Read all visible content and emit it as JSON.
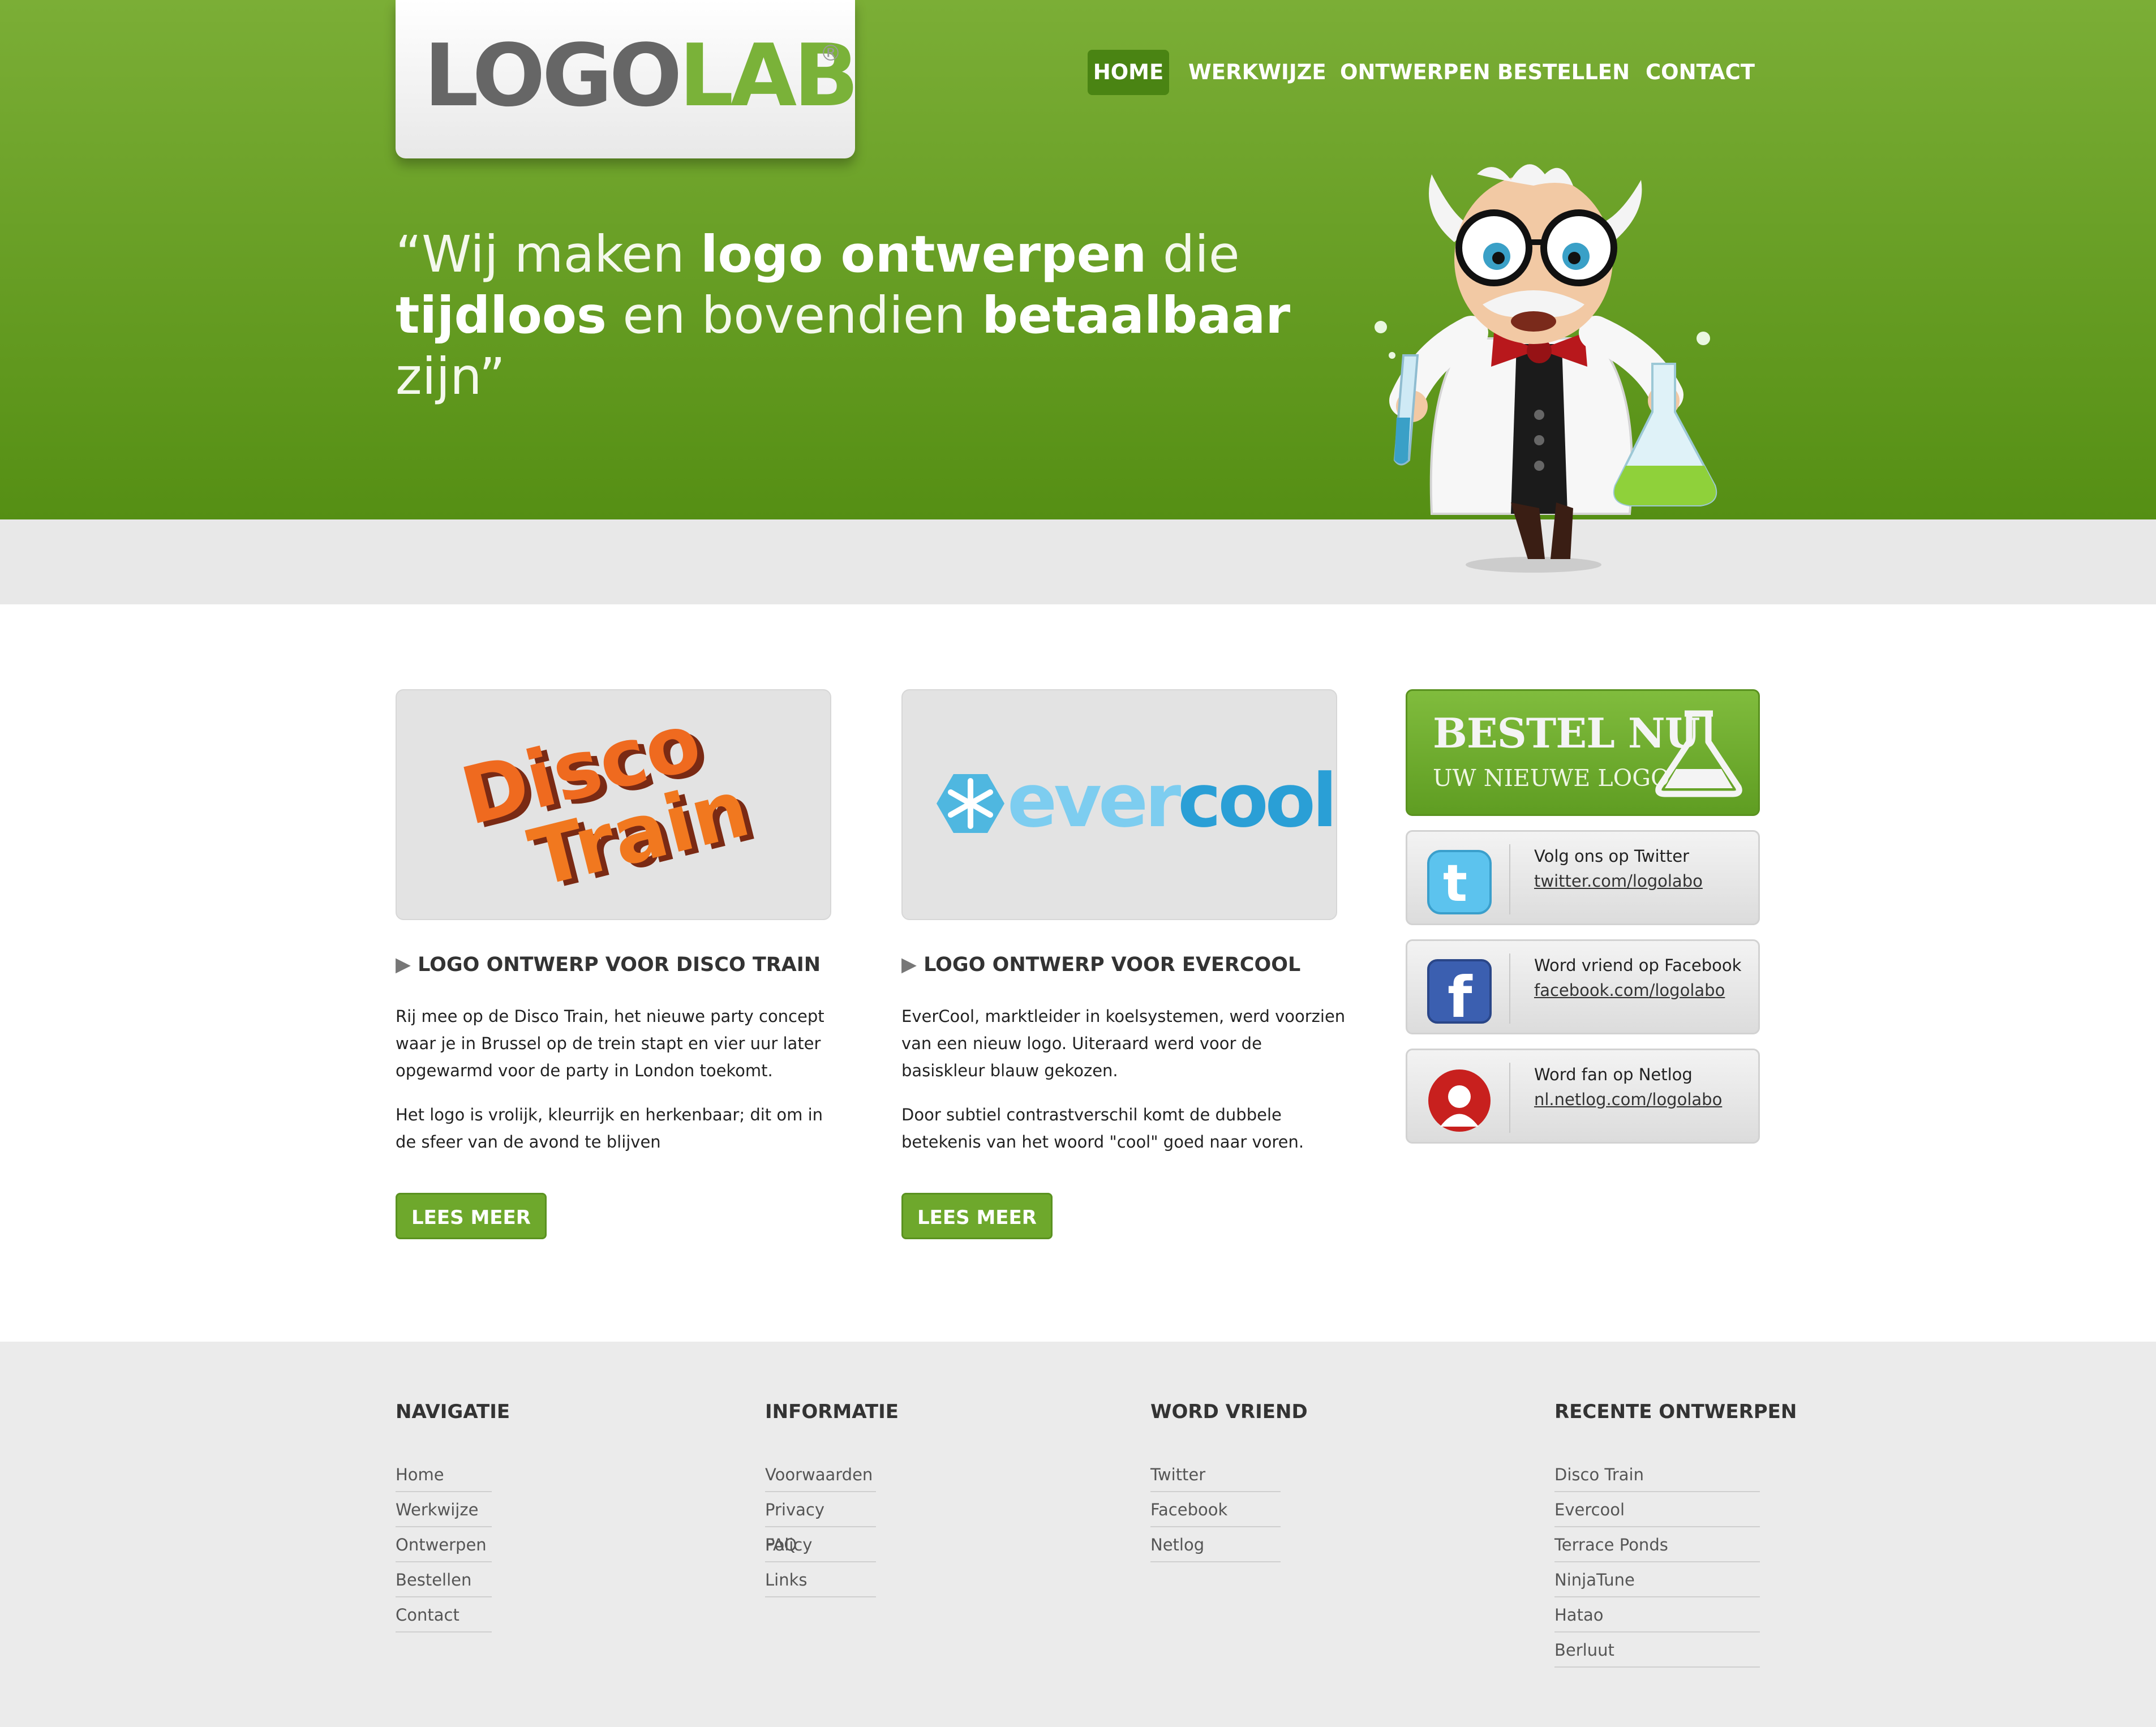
{
  "header": {
    "logo": {
      "part1": "LOGO",
      "part2": "LAB",
      "reg": "®"
    },
    "nav": [
      {
        "label": "HOME",
        "active": true
      },
      {
        "label": "WERKWIJZE",
        "active": false
      },
      {
        "label": "ONTWERPEN",
        "active": false
      },
      {
        "label": "BESTELLEN",
        "active": false
      },
      {
        "label": "CONTACT",
        "active": false
      }
    ],
    "tagline": {
      "l1_a": "“Wij maken ",
      "l1_b": "logo ontwerpen",
      "l1_c": " die",
      "l2_a": "tijdloos",
      "l2_b": " en bovendien ",
      "l2_c": "betaalbaar",
      "l2_d": " zijn”"
    }
  },
  "cards": [
    {
      "logo_l1": "Disco",
      "logo_l2": "Train",
      "title": "LOGO ONTWERP VOOR DISCO TRAIN",
      "p1": "Rij mee op de Disco Train, het nieuwe party concept waar je in Brussel op de trein stapt en vier uur later opgewarmd voor de party in London toekomt.",
      "p2": "Het logo is vrolijk, kleurrijk en herkenbaar; dit om in de sfeer van de avond te blijven",
      "button": "LEES MEER"
    },
    {
      "logo_a": "ever",
      "logo_b": "cool",
      "title": "LOGO ONTWERP VOOR EVERCOOL",
      "p1": "EverCool, marktleider in koelsystemen, werd voorzien van een nieuw logo. Uiteraard werd voor de basiskleur blauw gekozen.",
      "p2": "Door subtiel contrastverschil komt de dubbele betekenis van het woord \"cool\" goed naar voren.",
      "button": "LEES MEER"
    }
  ],
  "sidebar": {
    "bestel_title": "BESTEL NU",
    "bestel_sub": "UW NIEUWE LOGO",
    "social": [
      {
        "icon": "twitter-icon",
        "title": "Volg ons op Twitter",
        "link": "twitter.com/logolabo"
      },
      {
        "icon": "facebook-icon",
        "title": "Word vriend op Facebook",
        "link": "facebook.com/logolabo"
      },
      {
        "icon": "netlog-icon",
        "title": "Word fan op Netlog",
        "link": "nl.netlog.com/logolabo"
      }
    ]
  },
  "footer": {
    "columns": [
      {
        "heading": "NAVIGATIE",
        "links": [
          "Home",
          "Werkwijze",
          "Ontwerpen",
          "Bestellen",
          "Contact"
        ]
      },
      {
        "heading": "INFORMATIE",
        "links": [
          "Voorwaarden",
          "Privacy Policy",
          "FAQ",
          "Links"
        ]
      },
      {
        "heading": "WORD VRIEND",
        "links": [
          "Twitter",
          "Facebook",
          "Netlog"
        ]
      },
      {
        "heading": "RECENTE ONTWERPEN",
        "links": [
          "Disco Train",
          "Evercool",
          "Terrace Ponds",
          "NinjaTune",
          "Hatao",
          "Berluut"
        ]
      }
    ]
  },
  "colors": {
    "brand_green": "#6ea82c",
    "hero_top": "#7bae36",
    "hero_bottom": "#558f14",
    "footer_bg": "#ebebeb"
  }
}
